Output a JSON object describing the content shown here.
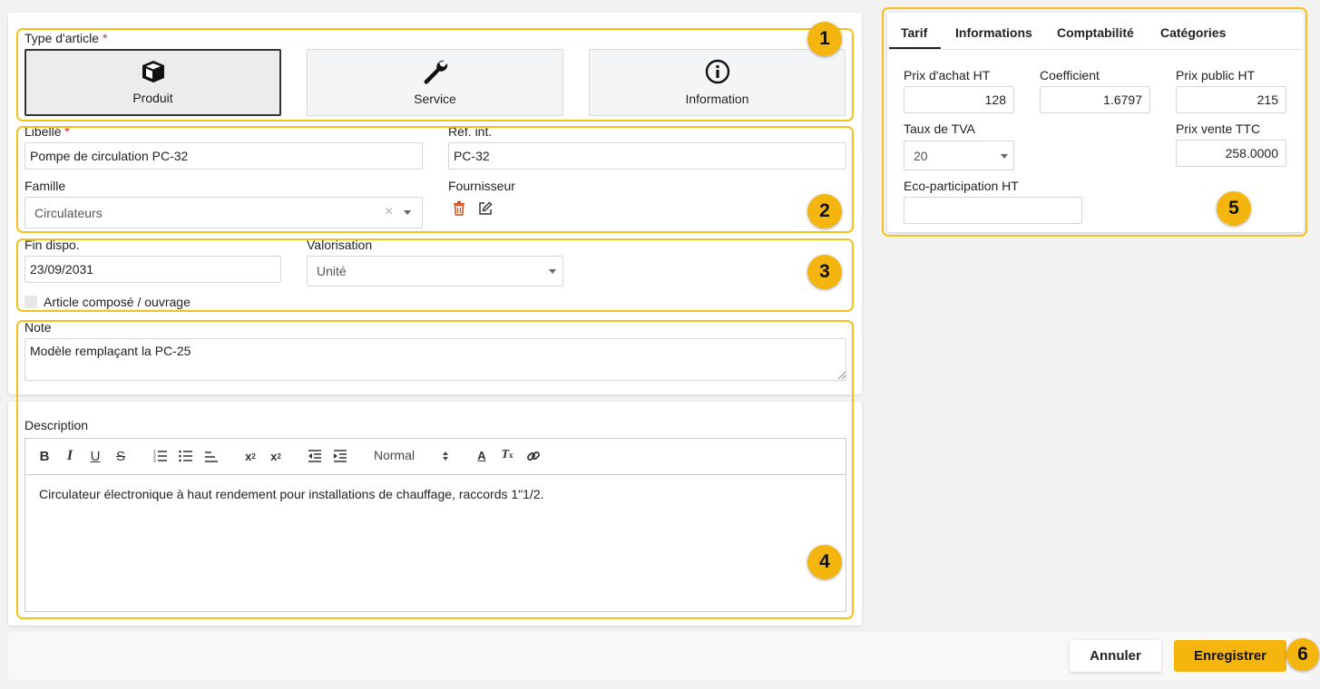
{
  "type_section": {
    "label": "Type d'article",
    "required_mark": "*",
    "options": [
      {
        "label": "Produit",
        "icon": "cube-icon",
        "selected": true
      },
      {
        "label": "Service",
        "icon": "wrench-icon",
        "selected": false
      },
      {
        "label": "Information",
        "icon": "info-icon",
        "selected": false
      }
    ]
  },
  "ident_section": {
    "libelle_label": "Libellé",
    "libelle_value": "Pompe de circulation PC-32",
    "ref_label": "Réf. int.",
    "ref_value": "PC-32",
    "famille_label": "Famille",
    "famille_value": "Circulateurs",
    "famille_clear": "×",
    "fournisseur_label": "Fournisseur"
  },
  "dispo_section": {
    "fin_label": "Fin dispo.",
    "fin_value": "23/09/2031",
    "valorisation_label": "Valorisation",
    "valorisation_value": "Unité",
    "compose_label": "Article composé / ouvrage",
    "compose_checked": false
  },
  "note_section": {
    "label": "Note",
    "value": "Modèle remplaçant la PC-25"
  },
  "description_section": {
    "label": "Description",
    "format_value": "Normal",
    "content": "Circulateur électronique à haut rendement pour installations de chauffage, raccords 1\"1/2."
  },
  "tabs": [
    "Tarif",
    "Informations",
    "Comptabilité",
    "Catégories"
  ],
  "active_tab": "Tarif",
  "tarif": {
    "prix_achat_label": "Prix d'achat HT",
    "prix_achat_value": "128",
    "coefficient_label": "Coefficient",
    "coefficient_value": "1.6797",
    "prix_public_label": "Prix public HT",
    "prix_public_value": "215",
    "tva_label": "Taux de TVA",
    "tva_value": "20",
    "prix_ttc_label": "Prix vente TTC",
    "prix_ttc_value": "258.0000",
    "eco_label": "Eco-participation HT",
    "eco_value": ""
  },
  "actions": {
    "cancel": "Annuler",
    "save": "Enregistrer"
  },
  "badges": [
    "1",
    "2",
    "3",
    "4",
    "5",
    "6"
  ],
  "colors": {
    "accent": "#f5b50f",
    "highlight_border": "#f5bf1c",
    "required": "#d9261c",
    "delete_icon": "#c8501e"
  }
}
